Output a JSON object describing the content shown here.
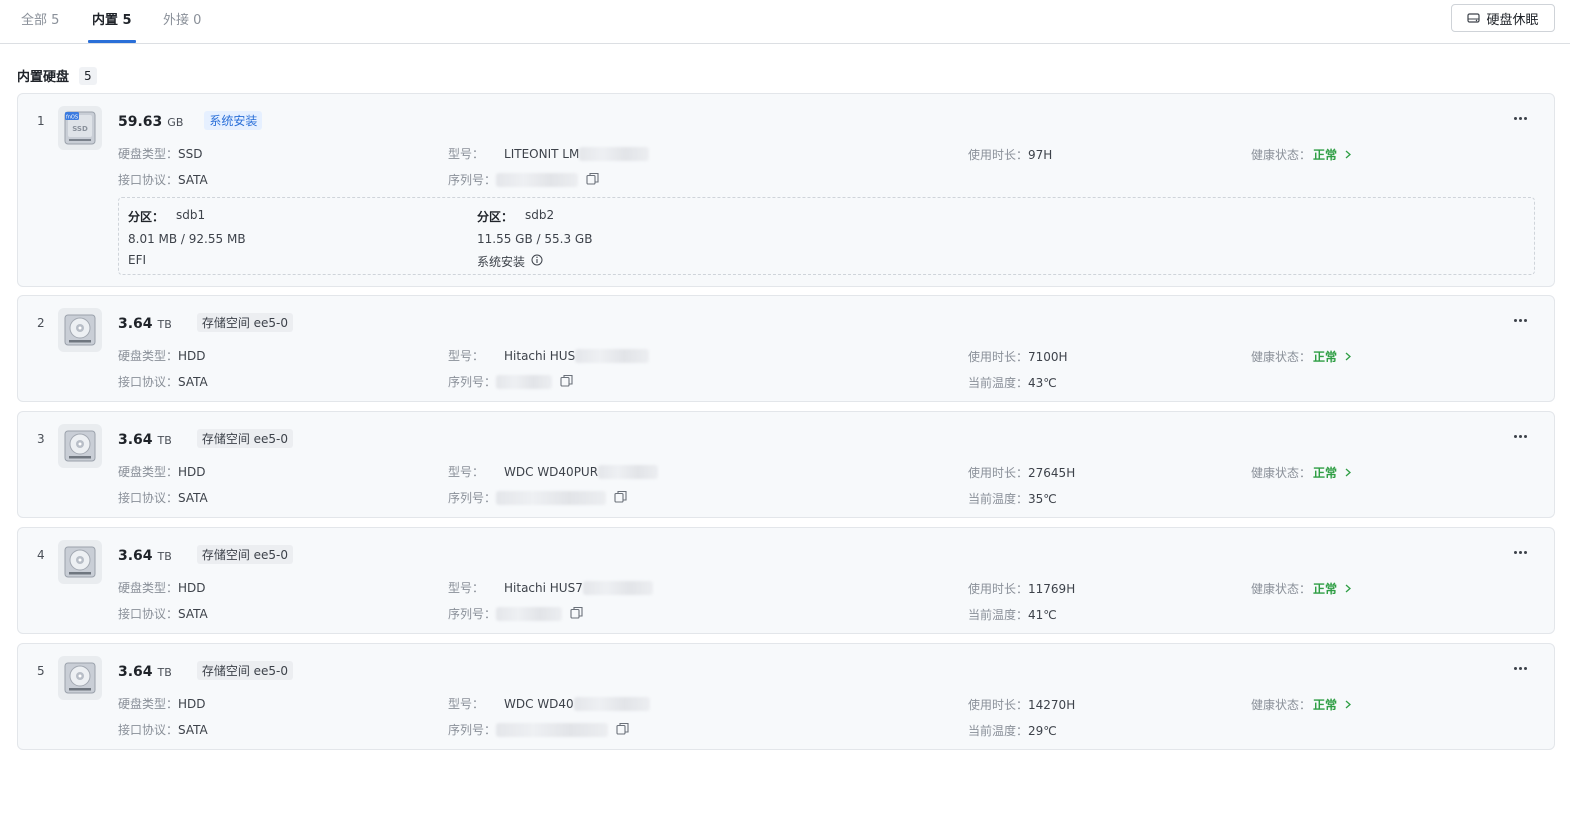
{
  "tabs": [
    {
      "label": "全部 5",
      "active": false
    },
    {
      "label": "内置 5",
      "active": true
    },
    {
      "label": "外接 0",
      "active": false
    }
  ],
  "sleep_button": "硬盘休眠",
  "section": {
    "title": "内置硬盘",
    "count": "5"
  },
  "labels": {
    "type": "硬盘类型：",
    "model": "型号：",
    "usage": "使用时长：",
    "health": "健康状态：",
    "interface": "接口协议：",
    "serial": "序列号：",
    "temp": "当前温度：",
    "partition": "分区："
  },
  "health_value": "正常",
  "disks": [
    {
      "index": "1",
      "capacity": "59.63",
      "unit": "GB",
      "tag": "系统安装",
      "tag_style": "blue",
      "type": "SSD",
      "interface": "SATA",
      "model": "LITEONIT LM",
      "usage": "97H",
      "temperature": "",
      "icon": "ssd-icon",
      "partitions": [
        {
          "name": "sdb1",
          "usage": "8.01 MB / 92.55 MB",
          "label": "EFI"
        },
        {
          "name": "sdb2",
          "usage": "11.55 GB / 55.3 GB",
          "label": "系统安装"
        }
      ]
    },
    {
      "index": "2",
      "capacity": "3.64",
      "unit": "TB",
      "tag": "存储空间 ee5-0",
      "tag_style": "gray",
      "type": "HDD",
      "interface": "SATA",
      "model": "Hitachi HUS",
      "usage": "7100H",
      "temperature": "43℃",
      "icon": "hdd-icon"
    },
    {
      "index": "3",
      "capacity": "3.64",
      "unit": "TB",
      "tag": "存储空间 ee5-0",
      "tag_style": "gray",
      "type": "HDD",
      "interface": "SATA",
      "model": "WDC WD40PUR",
      "usage": "27645H",
      "temperature": "35℃",
      "icon": "hdd-icon"
    },
    {
      "index": "4",
      "capacity": "3.64",
      "unit": "TB",
      "tag": "存储空间 ee5-0",
      "tag_style": "gray",
      "type": "HDD",
      "interface": "SATA",
      "model": "Hitachi HUS7",
      "usage": "11769H",
      "temperature": "41℃",
      "icon": "hdd-icon"
    },
    {
      "index": "5",
      "capacity": "3.64",
      "unit": "TB",
      "tag": "存储空间 ee5-0",
      "tag_style": "gray",
      "type": "HDD",
      "interface": "SATA",
      "model": "WDC WD40",
      "usage": "14270H",
      "temperature": "29℃",
      "icon": "hdd-icon"
    }
  ],
  "colors": {
    "accent": "#2a6fd8",
    "ok": "#2f9e44"
  }
}
